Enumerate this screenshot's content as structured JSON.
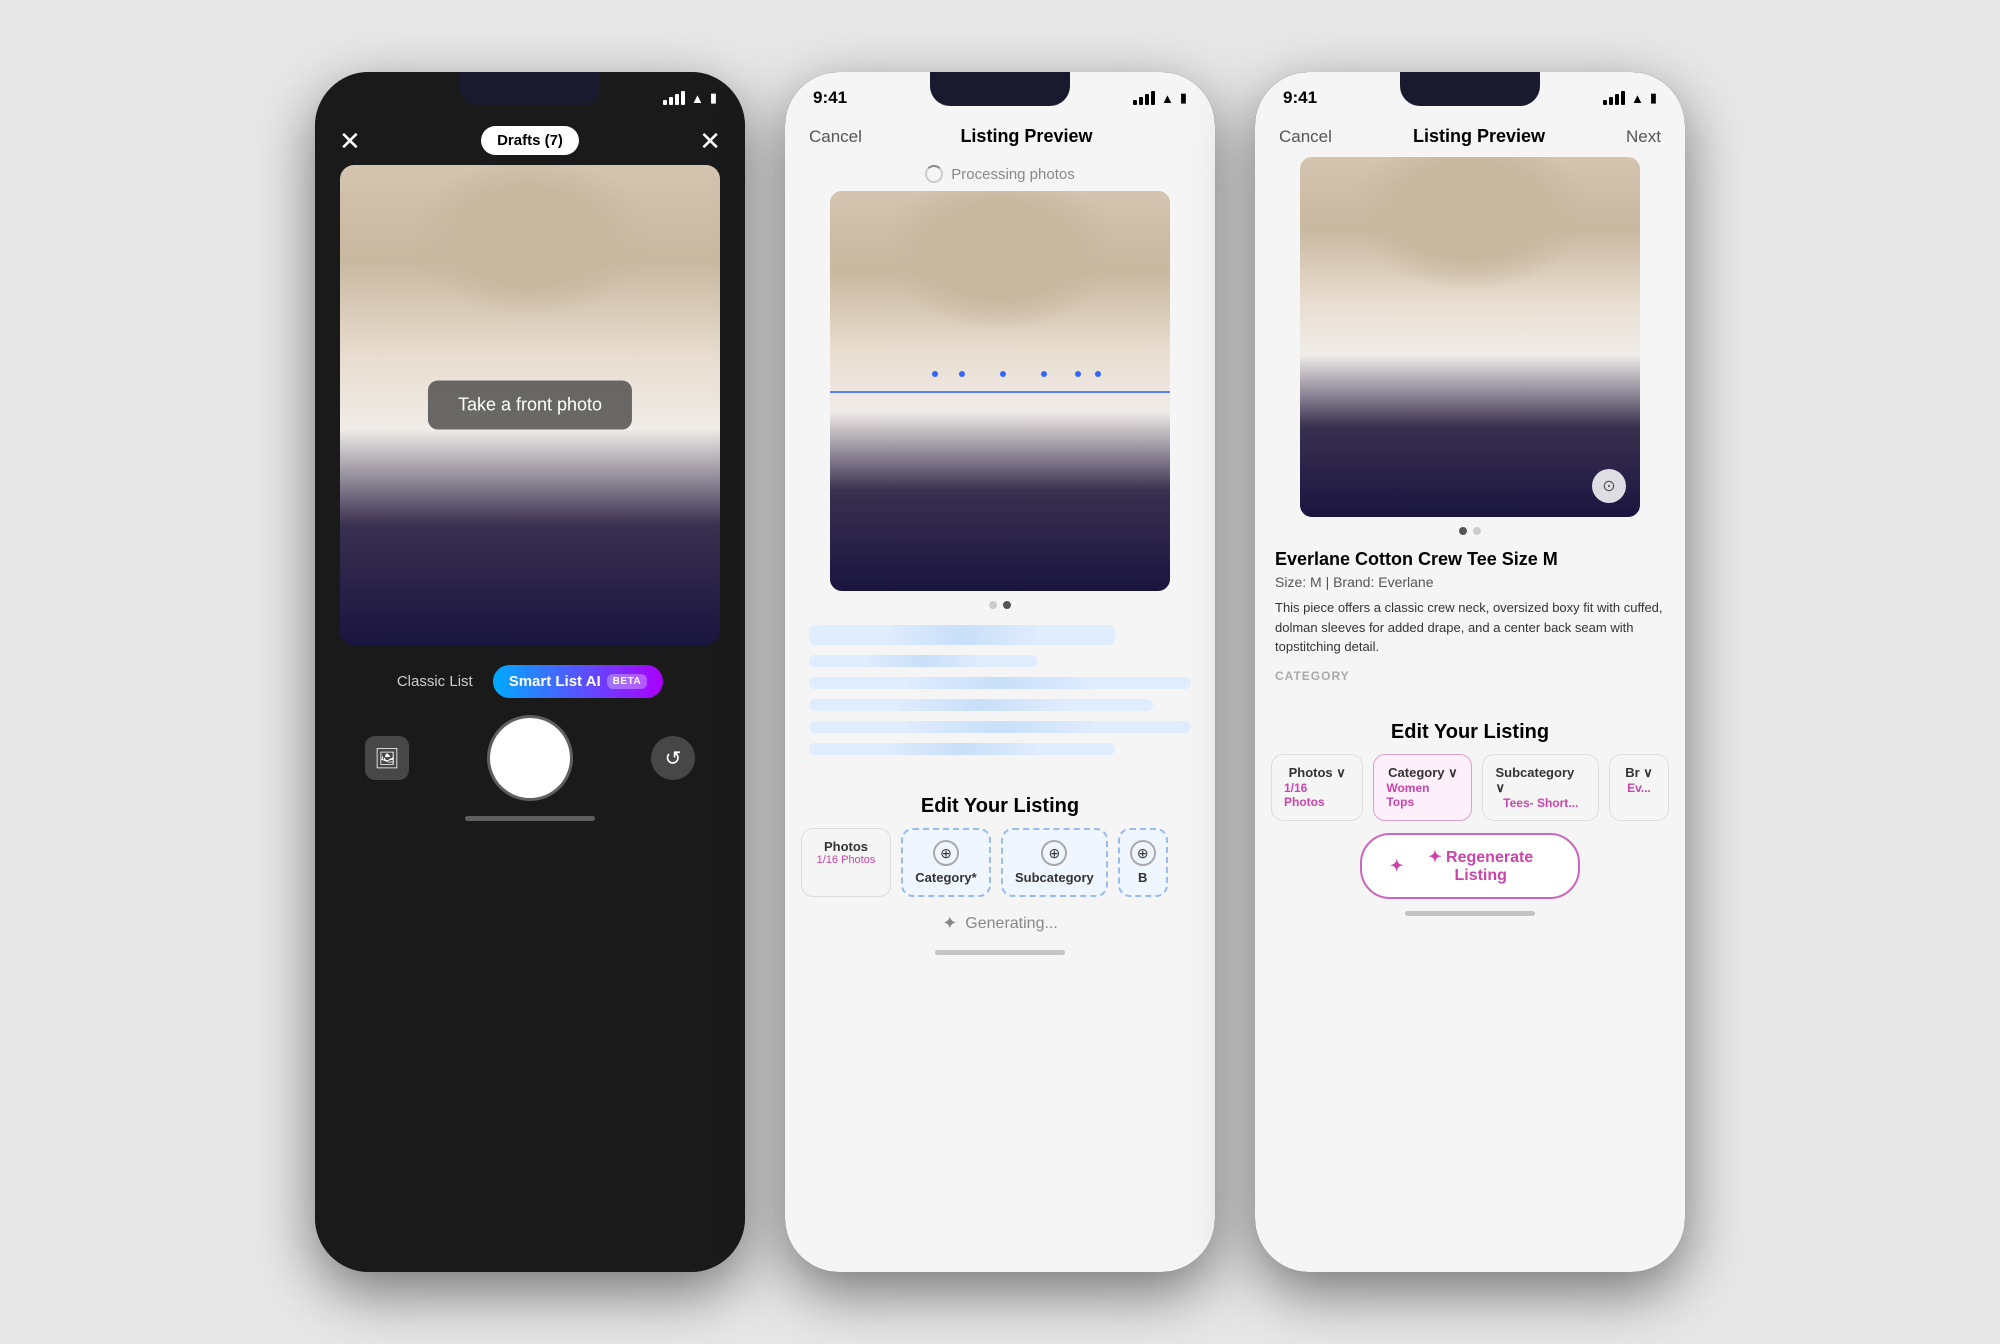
{
  "phone1": {
    "header": {
      "close_label": "✕",
      "drafts_label": "Drafts (7)",
      "flash_label": "✕"
    },
    "viewfinder": {
      "prompt_text": "Take a front photo"
    },
    "modes": {
      "classic_label": "Classic List",
      "smart_label": "Smart List AI",
      "beta_label": "BETA"
    },
    "controls": {
      "gallery_icon": "🖼",
      "flip_icon": "↺"
    }
  },
  "phone2": {
    "status_time": "9:41",
    "nav": {
      "cancel": "Cancel",
      "title": "Listing Preview",
      "next": ""
    },
    "processing_text": "Processing photos",
    "photo_dots": [
      "inactive",
      "active"
    ],
    "edit_listing": {
      "title": "Edit Your Listing",
      "tabs": [
        {
          "label": "Photos",
          "sublabel": "1/16 Photos",
          "icon": "↓",
          "active": false
        },
        {
          "label": "Category*",
          "sublabel": "",
          "icon": "⊕",
          "active": true
        },
        {
          "label": "Subcategory",
          "sublabel": "",
          "icon": "⊕",
          "active": true
        },
        {
          "label": "B",
          "sublabel": "",
          "icon": "⊕",
          "active": true
        }
      ]
    },
    "generating_text": "Generating..."
  },
  "phone3": {
    "status_time": "9:41",
    "nav": {
      "cancel": "Cancel",
      "title": "Listing Preview",
      "next": "Next"
    },
    "listing": {
      "title": "Everlane Cotton Crew Tee Size M",
      "meta": "Size: M  |  Brand: Everlane",
      "description": "This piece offers a classic crew neck, oversized boxy fit with cuffed, dolman sleeves for added drape, and a center back seam with topstitching detail.",
      "category_label": "CATEGORY"
    },
    "edit_listing": {
      "title": "Edit Your Listing",
      "tabs": [
        {
          "label": "Photos",
          "value": "1/16 Photos",
          "has_value": true
        },
        {
          "label": "Category",
          "value": "Women Tops",
          "has_value": true
        },
        {
          "label": "Subcategory",
          "value": "Tees- Short...",
          "has_value": true
        },
        {
          "label": "Br",
          "value": "Ev...",
          "has_value": true
        }
      ]
    },
    "regenerate_label": "✦ Regenerate Listing"
  },
  "colors": {
    "accent_pink": "#cc44aa",
    "accent_blue": "#3366ff",
    "bg_light": "#f5f5f5"
  }
}
